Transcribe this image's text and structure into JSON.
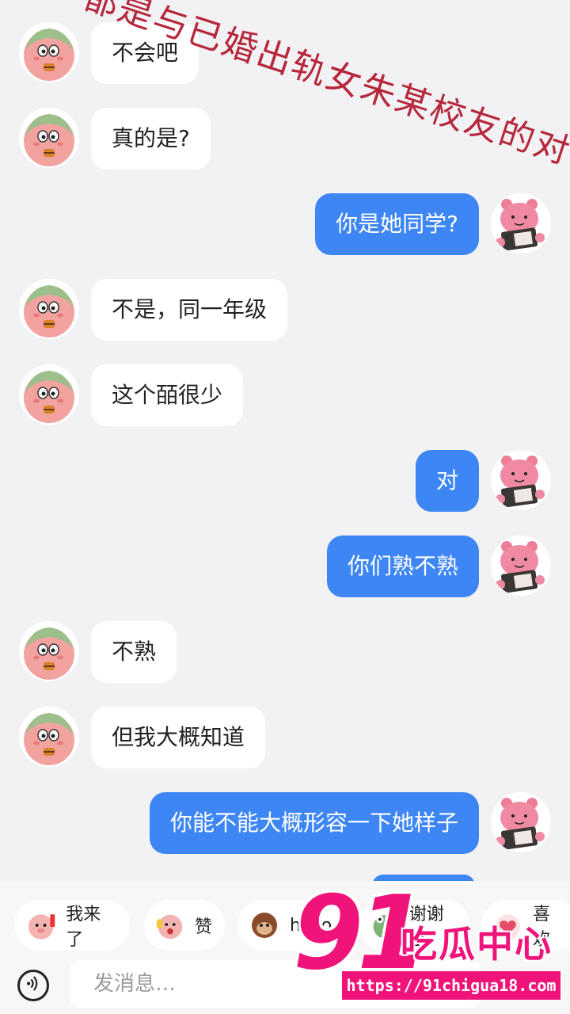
{
  "watermark": "都是与已婚出轨女朱某校友的对话",
  "messages": [
    {
      "side": "left",
      "text": "不会吧"
    },
    {
      "side": "left",
      "text": "真的是?"
    },
    {
      "side": "right",
      "text": "你是她同学?"
    },
    {
      "side": "left",
      "text": "不是，同一年级"
    },
    {
      "side": "left",
      "text": "这个皕很少"
    },
    {
      "side": "right",
      "text": "对"
    },
    {
      "side": "right",
      "text": "你们熟不熟"
    },
    {
      "side": "left",
      "text": "不熟"
    },
    {
      "side": "left",
      "text": "但我大概知道"
    },
    {
      "side": "right",
      "text": "你能不能大概形容一下她样子"
    }
  ],
  "quick_replies": [
    "我来了",
    "赞",
    "hello",
    "谢谢宝",
    "喜欢"
  ],
  "input": {
    "placeholder": "发消息…"
  },
  "logo": {
    "number": "91",
    "name": "吃瓜中心",
    "url": "https://91chigua18.com"
  },
  "colors": {
    "outgoing_bubble": "#3d86f4",
    "incoming_bubble": "#ffffff",
    "background": "#f2f2f4",
    "logo": "#f0147a",
    "watermark": "#b7273c"
  }
}
